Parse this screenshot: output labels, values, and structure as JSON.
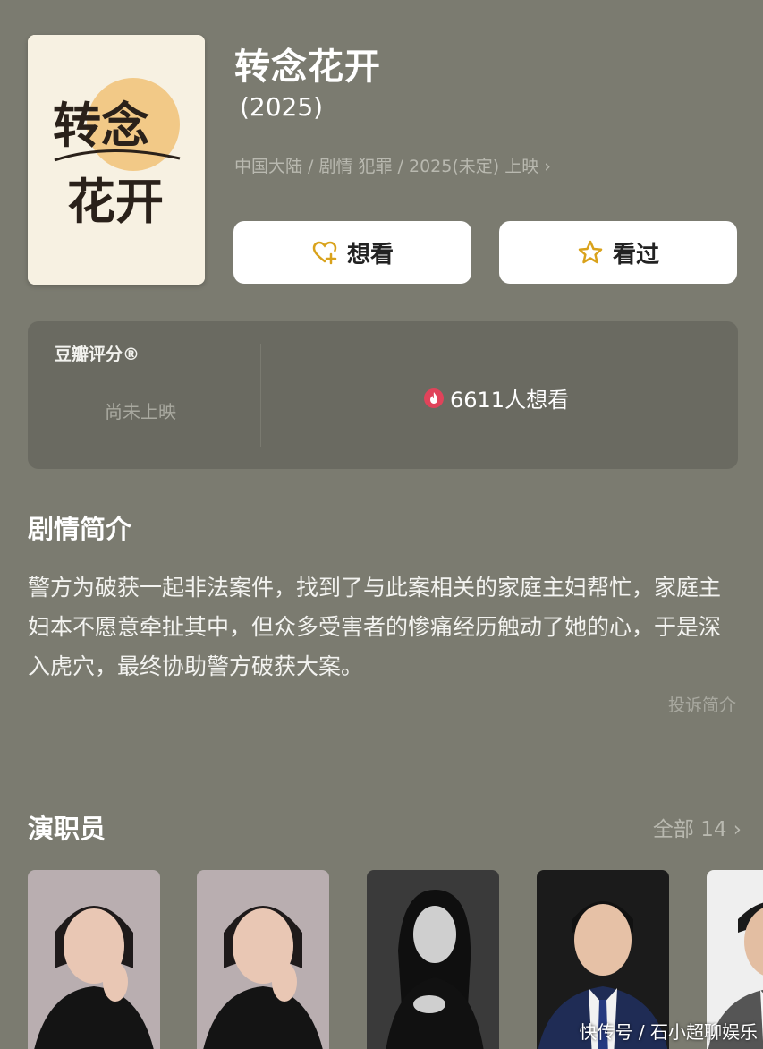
{
  "movie": {
    "title": "转念花开",
    "year": "(2025)",
    "meta": "中国大陆 / 剧情 犯罪 / 2025(未定) 上映",
    "poster_text": "转念花开"
  },
  "actions": {
    "want_label": "想看",
    "seen_label": "看过",
    "want_icon": "heart-plus-icon",
    "seen_icon": "star-icon"
  },
  "rating": {
    "label": "豆瓣评分®",
    "status": "尚未上映",
    "want_count": "6611人想看",
    "icon": "flame-icon"
  },
  "synopsis": {
    "heading": "剧情简介",
    "text": "警方为破获一起非法案件，找到了与此案相关的家庭主妇帮忙，家庭主妇本不愿意牵扯其中，但众多受害者的惨痛经历触动了她的心，于是深入虎穴，最终协助警方破获大案。",
    "report_link": "投诉简介"
  },
  "cast": {
    "heading": "演职员",
    "all_label": "全部 14",
    "members": [
      {
        "icon": "actor-photo"
      },
      {
        "icon": "actor-photo"
      },
      {
        "icon": "actor-photo"
      },
      {
        "icon": "actor-photo"
      },
      {
        "icon": "actor-photo"
      }
    ]
  },
  "watermark": "快传号 / 石小超聊娱乐",
  "colors": {
    "background": "#7b7b70",
    "card": "#6a6a61",
    "accent_yellow": "#d9a21b",
    "flame_red": "#e0435a"
  }
}
